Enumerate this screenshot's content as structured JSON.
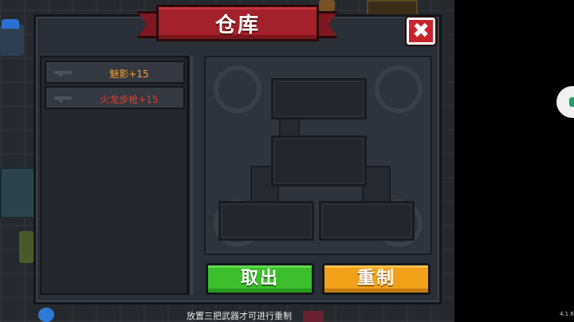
{
  "window": {
    "title": "仓库",
    "close_label": "✖"
  },
  "items": [
    {
      "name": "魅影+15",
      "color": "#f39c2b",
      "icon": "rifle-icon"
    },
    {
      "name": "火龙步枪+15",
      "color": "#e03a2e",
      "icon": "rifle-icon"
    }
  ],
  "buttons": {
    "take_out": "取出",
    "reforge": "重制"
  },
  "hint": "放置三把武器才可进行重制",
  "version": "4.1.6",
  "colors": {
    "banner": "#a3212a",
    "take_out": "#3cbf2c",
    "reforge": "#f1a21a",
    "close": "#c8232d"
  }
}
